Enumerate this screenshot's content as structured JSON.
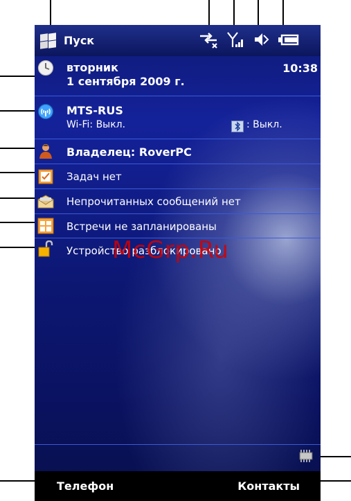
{
  "titlebar": {
    "start_label": "Пуск"
  },
  "status_icons": [
    "data-sync-icon",
    "signal-icon",
    "speaker-muted-icon",
    "battery-icon"
  ],
  "today": {
    "date": {
      "weekday": "вторник",
      "full_date": "1 сентября 2009 г.",
      "time": "10:38"
    },
    "network": {
      "operator": "MTS-RUS",
      "wifi_status": "Wi-Fi: Выкл.",
      "bluetooth_status": ": Выкл."
    },
    "owner": {
      "label": "Владелец: RoverPC"
    },
    "tasks": {
      "label": "Задач нет"
    },
    "messages": {
      "label": "Непрочитанных сообщений нет"
    },
    "calendar": {
      "label": "Встречи не запланированы"
    },
    "device_lock": {
      "label": "Устройство разблокировано"
    }
  },
  "softkeys": {
    "left": "Телефон",
    "right": "Контакты"
  },
  "watermark": "McGrp.Ru",
  "colors": {
    "titlebar": "#0c165e",
    "separator": "#3b5ad8",
    "background": "#0e1a74"
  }
}
